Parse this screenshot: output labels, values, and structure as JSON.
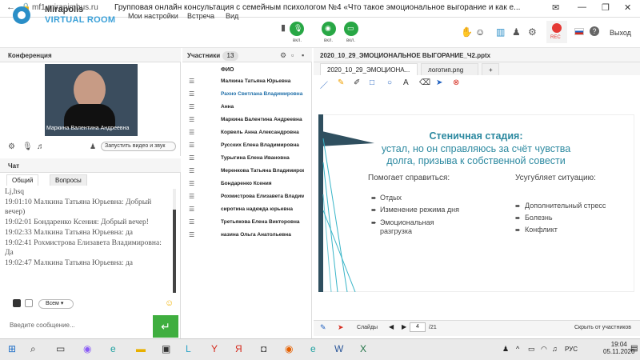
{
  "browser": {
    "url": "mf1.miranimbus.ru",
    "title": "Групповая онлайн консультация с семейным психологом №4 «Что такое эмоциональное выгорание и как е..."
  },
  "app": {
    "logo_top": "Mirapolis",
    "logo_bottom": "VIRTUAL ROOM",
    "menu": [
      "Мои настройки",
      "Встреча",
      "Вид"
    ],
    "media_buttons": [
      {
        "label": "вкл."
      },
      {
        "label": "вкл."
      },
      {
        "label": "вкл."
      }
    ],
    "rec_label": "REC",
    "logout": "Выход",
    "accent": "#3aa0d8",
    "green": "#28a745"
  },
  "conference": {
    "title": "Конференция",
    "video_caption": "Маркина Валентина Андреевна",
    "start_video": "Запустить видео и звук"
  },
  "chat": {
    "title": "Чат",
    "tabs": [
      "Общий",
      "Вопросы"
    ],
    "messages": [
      "Lj,hsq",
      "19:01:10 Малкина Татьяна Юрьевна: Добрый вечер)",
      "19:02:01 Бондаренко Ксения: Добрый вечер!",
      "19:02:33 Малкина Татьяна Юрьевна: да",
      "19:02:41 Рохмистрова Елизавета Владимировна: Да",
      "19:02:47 Малкина Татьяна Юрьевна: да"
    ],
    "recipients": "Всем",
    "input_placeholder": "Введите сообщение..."
  },
  "participants": {
    "title": "Участники",
    "count": "13",
    "column": "ФИО",
    "list": [
      "Малкина Татьяна Юрьевна",
      "Рахно Светлана Владимировна",
      "Анна",
      "Маркина Валентина Андреевна",
      "Корвель Анна Александровна",
      "Русских Елена Владимировна",
      "Турыгина Елена Ивановна",
      "Меренкова Татьяна Владимировна",
      "Бондаренко Ксения",
      "Рохмистрова Елизавета Владимировна",
      "сиротина надежда юрьевна",
      "Третьякова Елена Викторовна",
      "назина Ольга Анатольевна"
    ]
  },
  "presentation": {
    "title": "2020_10_29_ЭМОЦИОНАЛЬНОЕ ВЫГОРАНИЕ_Ч2.pptx",
    "tabs": [
      "2020_10_29_ЭМОЦИОНА...",
      "логотип.png",
      "+"
    ],
    "slide": {
      "title_bold": "Стеничная стадия:",
      "title_rest": "устал, но он справляюсь за счёт чувства долга, призыва к собственной совести",
      "left_head": "Помогает справиться:",
      "left_items": [
        "Отдых",
        "Изменение режима дня",
        "Эмоциональная разгрузка"
      ],
      "right_head": "Усугубляет ситуацию:",
      "right_items": [
        "Дополнительный стресс",
        "Болезнь",
        "Конфликт"
      ]
    },
    "slides_label": "Слайды",
    "current_slide": "4",
    "total_slides": "/21",
    "hide_label": "Скрыть от участников"
  },
  "taskbar": {
    "lang": "РУС",
    "time": "19:04",
    "date": "05.11.2020"
  }
}
